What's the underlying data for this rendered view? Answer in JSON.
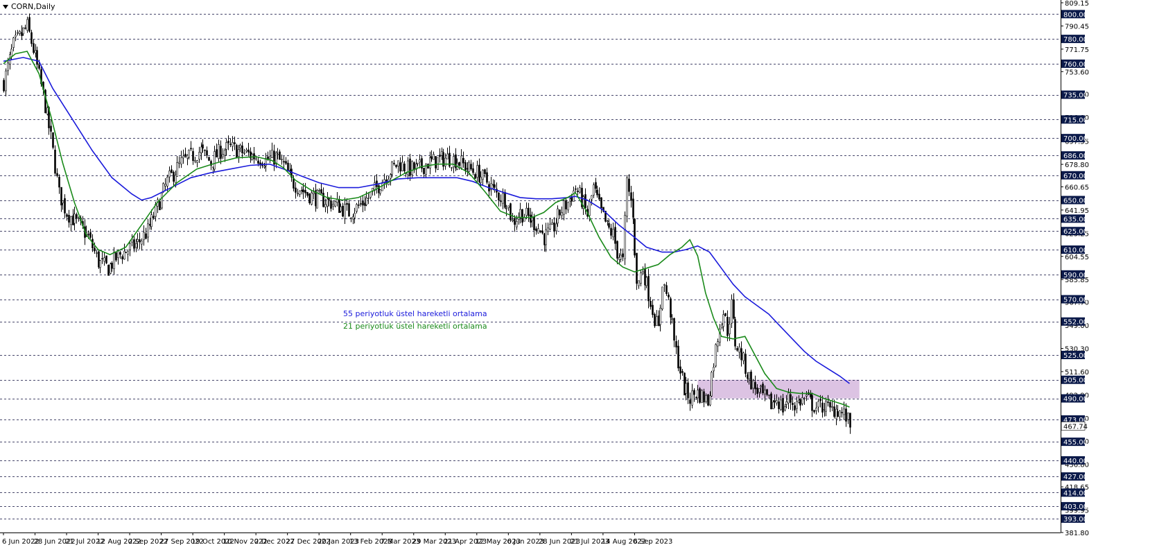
{
  "header": {
    "symbol": "CORN,Daily"
  },
  "chart_data": {
    "type": "candlestick",
    "y_range": [
      381.8,
      809.15
    ],
    "price_axis_ticks": [
      "809.15",
      "790.45",
      "771.75",
      "753.60",
      "735.50",
      "716.80",
      "697.55",
      "678.80",
      "660.65",
      "641.95",
      "623.25",
      "604.55",
      "585.85",
      "567.70",
      "549.00",
      "530.30",
      "511.60",
      "492.90",
      "474.20",
      "455.50",
      "436.80",
      "418.65",
      "399.95",
      "381.80"
    ],
    "level_lines": [
      {
        "value": 800.0,
        "label": "800.00"
      },
      {
        "value": 780.0,
        "label": "780.00"
      },
      {
        "value": 760.0,
        "label": "760.00"
      },
      {
        "value": 735.0,
        "label": "735.00"
      },
      {
        "value": 715.0,
        "label": "715.00"
      },
      {
        "value": 700.0,
        "label": "700.00"
      },
      {
        "value": 686.0,
        "label": "686.00"
      },
      {
        "value": 670.0,
        "label": "670.00"
      },
      {
        "value": 650.0,
        "label": "650.00"
      },
      {
        "value": 635.0,
        "label": "635.00"
      },
      {
        "value": 625.0,
        "label": "625.00"
      },
      {
        "value": 610.0,
        "label": "610.00"
      },
      {
        "value": 590.0,
        "label": "590.00"
      },
      {
        "value": 570.0,
        "label": "570.00"
      },
      {
        "value": 552.0,
        "label": "552.00"
      },
      {
        "value": 525.0,
        "label": "525.00"
      },
      {
        "value": 505.0,
        "label": "505.00"
      },
      {
        "value": 490.0,
        "label": "490.00"
      },
      {
        "value": 473.0,
        "label": "473.00"
      },
      {
        "value": 455.0,
        "label": "455.00"
      },
      {
        "value": 440.0,
        "label": "440.00"
      },
      {
        "value": 427.0,
        "label": "427.00"
      },
      {
        "value": 414.0,
        "label": "414.00"
      },
      {
        "value": 403.0,
        "label": "403.00"
      },
      {
        "value": 393.0,
        "label": "393.00"
      }
    ],
    "current_price": {
      "value": 467.74,
      "label": "467.74"
    },
    "x_labels": [
      "6 Jun 2022",
      "28 Jun 2022",
      "21 Jul 2022",
      "12 Aug 2022",
      "2 Sep 2022",
      "27 Sep 2022",
      "19 Oct 2022",
      "10 Nov 2022",
      "2 Dec 2022",
      "27 Dec 2022",
      "20 Jan 2023",
      "13 Feb 2023",
      "7 Mar 2023",
      "29 Mar 2023",
      "21 Apr 2023",
      "12 May 2023",
      "6 Jun 2023",
      "28 Jun 2023",
      "21 Jul 2023",
      "14 Aug 2023",
      "6 Sep 2023"
    ],
    "bars_per_label": 16,
    "close_path": [
      [
        0,
        745
      ],
      [
        5,
        775
      ],
      [
        12,
        790
      ],
      [
        16,
        765
      ],
      [
        20,
        735
      ],
      [
        24,
        700
      ],
      [
        28,
        655
      ],
      [
        32,
        640
      ],
      [
        38,
        630
      ],
      [
        43,
        620
      ],
      [
        48,
        600
      ],
      [
        53,
        595
      ],
      [
        58,
        605
      ],
      [
        63,
        610
      ],
      [
        68,
        615
      ],
      [
        73,
        625
      ],
      [
        78,
        645
      ],
      [
        83,
        665
      ],
      [
        90,
        680
      ],
      [
        95,
        685
      ],
      [
        100,
        690
      ],
      [
        105,
        680
      ],
      [
        110,
        690
      ],
      [
        115,
        692
      ],
      [
        122,
        688
      ],
      [
        128,
        685
      ],
      [
        133,
        682
      ],
      [
        138,
        685
      ],
      [
        142,
        678
      ],
      [
        146,
        665
      ],
      [
        150,
        660
      ],
      [
        154,
        655
      ],
      [
        158,
        652
      ],
      [
        162,
        650
      ],
      [
        166,
        648
      ],
      [
        170,
        645
      ],
      [
        175,
        640
      ],
      [
        180,
        645
      ],
      [
        185,
        652
      ],
      [
        190,
        662
      ],
      [
        195,
        672
      ],
      [
        200,
        680
      ],
      [
        205,
        675
      ],
      [
        210,
        675
      ],
      [
        215,
        680
      ],
      [
        220,
        682
      ],
      [
        225,
        684
      ],
      [
        230,
        682
      ],
      [
        235,
        676
      ],
      [
        240,
        672
      ],
      [
        245,
        665
      ],
      [
        250,
        655
      ],
      [
        255,
        650
      ],
      [
        258,
        632
      ],
      [
        262,
        640
      ],
      [
        266,
        636
      ],
      [
        270,
        630
      ],
      [
        274,
        620
      ],
      [
        278,
        625
      ],
      [
        282,
        640
      ],
      [
        286,
        648
      ],
      [
        290,
        660
      ],
      [
        293,
        650
      ],
      [
        296,
        638
      ],
      [
        299,
        660
      ],
      [
        303,
        640
      ],
      [
        306,
        628
      ],
      [
        309,
        622
      ],
      [
        311,
        608
      ],
      [
        314,
        600
      ],
      [
        316,
        665
      ],
      [
        319,
        640
      ],
      [
        321,
        580
      ],
      [
        324,
        595
      ],
      [
        327,
        575
      ],
      [
        330,
        555
      ],
      [
        332,
        545
      ],
      [
        334,
        585
      ],
      [
        336,
        575
      ],
      [
        338,
        560
      ],
      [
        340,
        535
      ],
      [
        342,
        520
      ],
      [
        345,
        498
      ],
      [
        348,
        490
      ],
      [
        351,
        495
      ],
      [
        354,
        492
      ],
      [
        357,
        488
      ],
      [
        360,
        520
      ],
      [
        363,
        550
      ],
      [
        365,
        560
      ],
      [
        367,
        545
      ],
      [
        369,
        565
      ],
      [
        371,
        535
      ],
      [
        374,
        525
      ],
      [
        377,
        510
      ],
      [
        380,
        500
      ],
      [
        383,
        495
      ],
      [
        386,
        490
      ],
      [
        389,
        485
      ],
      [
        392,
        490
      ],
      [
        395,
        482
      ],
      [
        398,
        490
      ],
      [
        401,
        485
      ],
      [
        404,
        488
      ],
      [
        407,
        490
      ],
      [
        410,
        485
      ],
      [
        413,
        482
      ],
      [
        416,
        485
      ],
      [
        419,
        480
      ],
      [
        422,
        482
      ],
      [
        425,
        478
      ],
      [
        427,
        475
      ],
      [
        429,
        468
      ]
    ],
    "series": [
      {
        "name": "55 periyotluk üstel hareketli ortalama",
        "color": "#1a1adb",
        "points": [
          [
            0,
            762
          ],
          [
            10,
            765
          ],
          [
            18,
            762
          ],
          [
            25,
            740
          ],
          [
            35,
            715
          ],
          [
            45,
            690
          ],
          [
            55,
            668
          ],
          [
            65,
            655
          ],
          [
            70,
            650
          ],
          [
            75,
            652
          ],
          [
            85,
            660
          ],
          [
            95,
            668
          ],
          [
            105,
            672
          ],
          [
            115,
            675
          ],
          [
            125,
            678
          ],
          [
            135,
            679
          ],
          [
            142,
            675
          ],
          [
            150,
            670
          ],
          [
            160,
            664
          ],
          [
            170,
            660
          ],
          [
            180,
            660
          ],
          [
            190,
            663
          ],
          [
            200,
            667
          ],
          [
            210,
            668
          ],
          [
            220,
            668
          ],
          [
            230,
            668
          ],
          [
            238,
            665
          ],
          [
            246,
            660
          ],
          [
            254,
            656
          ],
          [
            262,
            652
          ],
          [
            270,
            651
          ],
          [
            278,
            651
          ],
          [
            286,
            652
          ],
          [
            290,
            653
          ],
          [
            296,
            650
          ],
          [
            304,
            642
          ],
          [
            312,
            630
          ],
          [
            320,
            620
          ],
          [
            326,
            612
          ],
          [
            334,
            608
          ],
          [
            340,
            608
          ],
          [
            346,
            610
          ],
          [
            352,
            613
          ],
          [
            358,
            608
          ],
          [
            364,
            595
          ],
          [
            370,
            582
          ],
          [
            376,
            572
          ],
          [
            382,
            565
          ],
          [
            388,
            558
          ],
          [
            394,
            548
          ],
          [
            400,
            538
          ],
          [
            406,
            528
          ],
          [
            412,
            520
          ],
          [
            418,
            514
          ],
          [
            424,
            508
          ],
          [
            429,
            502
          ]
        ]
      },
      {
        "name": "21 periyotluk üstel hareketli ortalama",
        "color": "#1a8a1a",
        "points": [
          [
            0,
            760
          ],
          [
            6,
            768
          ],
          [
            12,
            770
          ],
          [
            18,
            752
          ],
          [
            24,
            718
          ],
          [
            30,
            680
          ],
          [
            36,
            648
          ],
          [
            42,
            622
          ],
          [
            48,
            610
          ],
          [
            54,
            606
          ],
          [
            62,
            612
          ],
          [
            70,
            630
          ],
          [
            78,
            648
          ],
          [
            88,
            664
          ],
          [
            98,
            675
          ],
          [
            108,
            680
          ],
          [
            118,
            684
          ],
          [
            128,
            685
          ],
          [
            136,
            682
          ],
          [
            142,
            676
          ],
          [
            148,
            666
          ],
          [
            156,
            658
          ],
          [
            164,
            652
          ],
          [
            172,
            650
          ],
          [
            180,
            652
          ],
          [
            188,
            658
          ],
          [
            196,
            665
          ],
          [
            204,
            672
          ],
          [
            212,
            677
          ],
          [
            220,
            679
          ],
          [
            228,
            679
          ],
          [
            236,
            672
          ],
          [
            244,
            657
          ],
          [
            252,
            641
          ],
          [
            260,
            636
          ],
          [
            268,
            636
          ],
          [
            274,
            640
          ],
          [
            280,
            648
          ],
          [
            286,
            652
          ],
          [
            290,
            656
          ],
          [
            296,
            640
          ],
          [
            302,
            620
          ],
          [
            308,
            604
          ],
          [
            314,
            596
          ],
          [
            320,
            592
          ],
          [
            326,
            595
          ],
          [
            332,
            598
          ],
          [
            338,
            606
          ],
          [
            344,
            612
          ],
          [
            348,
            618
          ],
          [
            352,
            605
          ],
          [
            356,
            575
          ],
          [
            360,
            555
          ],
          [
            364,
            540
          ],
          [
            370,
            538
          ],
          [
            376,
            540
          ],
          [
            380,
            528
          ],
          [
            386,
            510
          ],
          [
            392,
            498
          ],
          [
            398,
            495
          ],
          [
            404,
            494
          ],
          [
            410,
            494
          ],
          [
            416,
            490
          ],
          [
            422,
            487
          ],
          [
            426,
            485
          ],
          [
            429,
            483
          ]
        ]
      }
    ],
    "annotations": [
      "55 periyotluk üstel hareketli ortalama",
      "21 periyotluk üstel hareketli ortalama"
    ],
    "zone": {
      "from_bar": 352,
      "to_bar": 434,
      "low": 490,
      "high": 505,
      "color": "#dcc3e3"
    }
  }
}
